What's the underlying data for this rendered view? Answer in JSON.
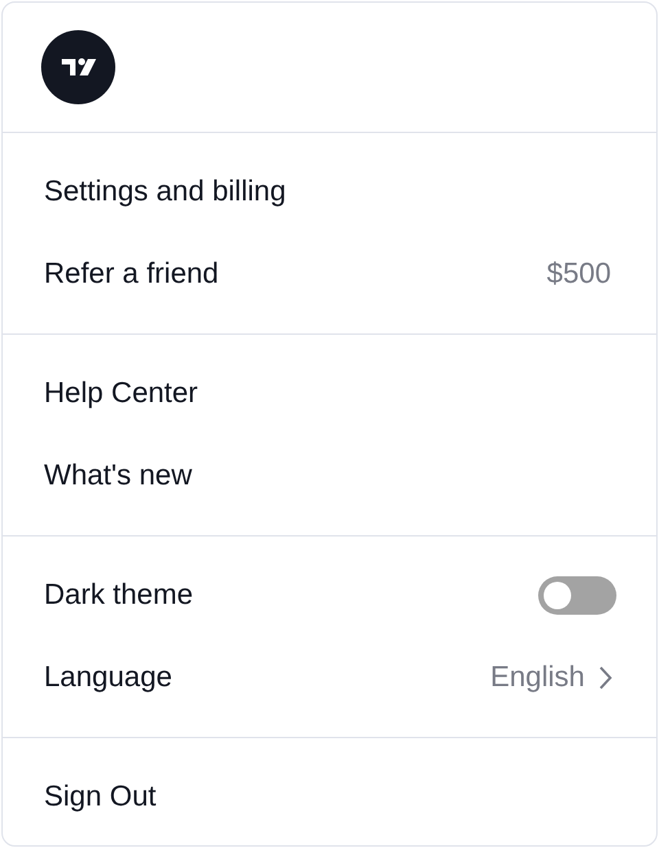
{
  "sections": [
    {
      "items": [
        {
          "kind": "link",
          "label": "Settings and billing"
        },
        {
          "kind": "value",
          "label": "Refer a friend",
          "value": "$500"
        }
      ]
    },
    {
      "items": [
        {
          "kind": "link",
          "label": "Help Center"
        },
        {
          "kind": "link",
          "label": "What's new"
        }
      ]
    },
    {
      "items": [
        {
          "kind": "toggle",
          "label": "Dark theme",
          "on": false
        },
        {
          "kind": "select",
          "label": "Language",
          "value": "English"
        }
      ]
    },
    {
      "items": [
        {
          "kind": "link",
          "label": "Sign Out"
        }
      ]
    }
  ]
}
